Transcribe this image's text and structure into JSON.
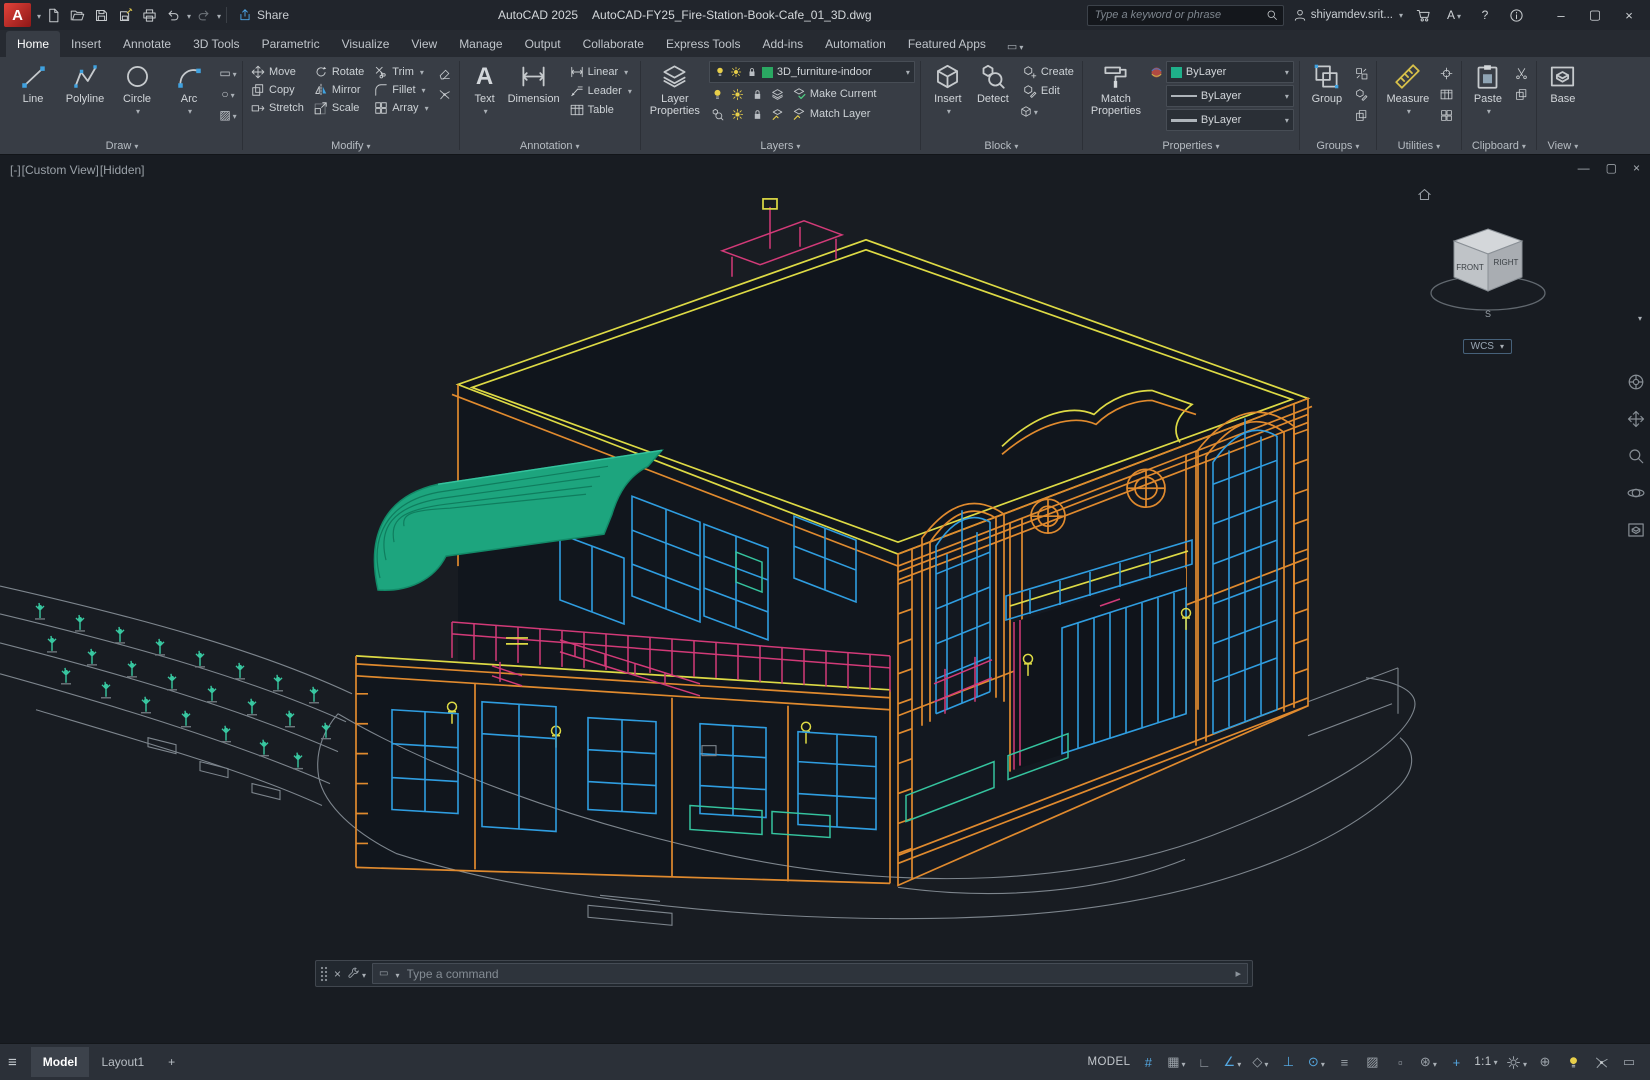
{
  "palette": {
    "wall_orange": "#e08a2e",
    "roof_yellow": "#ddda45",
    "window_blue": "#2f9de0",
    "railing_magenta": "#d23a78",
    "awning_green": "#1da57e",
    "plant_teal": "#38c7a0",
    "road_gray": "#7d858d",
    "layer_swatch_green": "#2aa862",
    "status_on_blue": "#54a7e0"
  },
  "titlebar": {
    "app_logo": "A",
    "share_label": "Share",
    "app_title": "AutoCAD 2025",
    "doc_title": "AutoCAD-FY25_Fire-Station-Book-Cafe_01_3D.dwg",
    "search_placeholder": "Type a keyword or phrase",
    "user_name": "shiyamdev.srit...",
    "help_label": "?",
    "apps_label": "A"
  },
  "ribbon_tabs": {
    "items": [
      "Home",
      "Insert",
      "Annotate",
      "3D Tools",
      "Parametric",
      "Visualize",
      "View",
      "Manage",
      "Output",
      "Collaborate",
      "Express Tools",
      "Add-ins",
      "Automation",
      "Featured Apps"
    ],
    "active": "Home"
  },
  "panels": {
    "draw": {
      "label": "Draw",
      "line": "Line",
      "polyline": "Polyline",
      "circle": "Circle",
      "arc": "Arc"
    },
    "modify": {
      "label": "Modify",
      "move": "Move",
      "rotate": "Rotate",
      "trim": "Trim",
      "copy": "Copy",
      "mirror": "Mirror",
      "fillet": "Fillet",
      "stretch": "Stretch",
      "scale": "Scale",
      "array": "Array"
    },
    "annotation": {
      "label": "Annotation",
      "text": "Text",
      "dimension": "Dimension",
      "linear": "Linear",
      "leader": "Leader",
      "table": "Table"
    },
    "layers": {
      "label": "Layers",
      "layer_properties": "Layer Properties",
      "current_layer": "3D_furniture-indoor",
      "make_current": "Make Current",
      "match_layer": "Match Layer"
    },
    "block": {
      "label": "Block",
      "insert": "Insert",
      "detect": "Detect",
      "create": "Create",
      "edit": "Edit"
    },
    "properties": {
      "label": "Properties",
      "match_properties": "Match Properties",
      "color_value": "ByLayer",
      "linetype_value": "ByLayer",
      "lineweight_value": "ByLayer"
    },
    "groups": {
      "label": "Groups",
      "group": "Group"
    },
    "utilities": {
      "label": "Utilities",
      "measure": "Measure"
    },
    "clipboard": {
      "label": "Clipboard",
      "paste": "Paste"
    },
    "view": {
      "label": "View",
      "base": "Base"
    }
  },
  "viewport": {
    "vp_controls": "[-]",
    "vp_view": "[Custom View]",
    "vp_visual": "[Hidden]",
    "viewcube": {
      "front": "FRONT",
      "right": "RIGHT",
      "south": "S"
    },
    "wcs": "WCS",
    "command_placeholder": "Type a command"
  },
  "statusbar": {
    "model_tab": "Model",
    "layout1_tab": "Layout1",
    "add_layout": "+",
    "model_space": "MODEL",
    "annotation_scale": "1:1"
  },
  "glyphs": {
    "hamburger": "≡",
    "window_minimize": "–",
    "window_maximize": "▢",
    "window_close": "×",
    "vp_minimize": "—",
    "vp_restore": "▢",
    "vp_close": "×",
    "ribbon_display_box": "▭",
    "draw_rect": "▭",
    "draw_circle_alt": "○",
    "draw_hatch": "▨",
    "grid": "#",
    "snap": "▦",
    "ortho": "∟",
    "polar": "∠",
    "isodraft": "◇",
    "otrack": "⊥",
    "osnap": "⊙",
    "lineweight": "≡",
    "transparency": "▨",
    "selection_cycling": "▫",
    "osnap_3d": "⊛",
    "dynamic_input": "+",
    "annotation_monitor": "⊕",
    "clean_screen": "▭",
    "cmd_recent_box": "▭",
    "cmd_expand": "▸"
  }
}
